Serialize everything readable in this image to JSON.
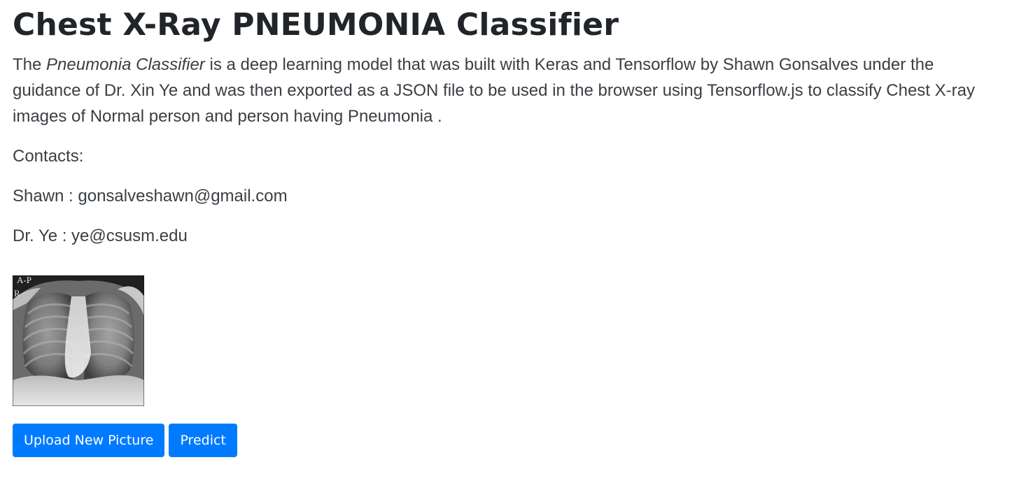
{
  "header": {
    "title": "Chest X-Ray PNEUMONIA Classifier"
  },
  "intro": {
    "prefix": "The ",
    "model_name": "Pneumonia Classifier",
    "body": " is a deep learning model that was built with Keras and Tensorflow by Shawn Gonsalves under the guidance of Dr. Xin Ye and was then exported as a JSON file to be used in the browser using Tensorflow.js to classify Chest X-ray images of Normal person and person having Pneumonia ."
  },
  "contacts": {
    "label": "Contacts:",
    "items": [
      {
        "text": "Shawn : gonsalveshawn@gmail.com"
      },
      {
        "text": "Dr. Ye : ye@csusm.edu"
      }
    ]
  },
  "preview": {
    "marker_top": "A-P",
    "marker_side": "R"
  },
  "actions": {
    "upload_label": "Upload New Picture",
    "predict_label": "Predict"
  },
  "colors": {
    "primary_button": "#007bff",
    "heading_text": "#212529",
    "body_text": "#3a3f44"
  }
}
